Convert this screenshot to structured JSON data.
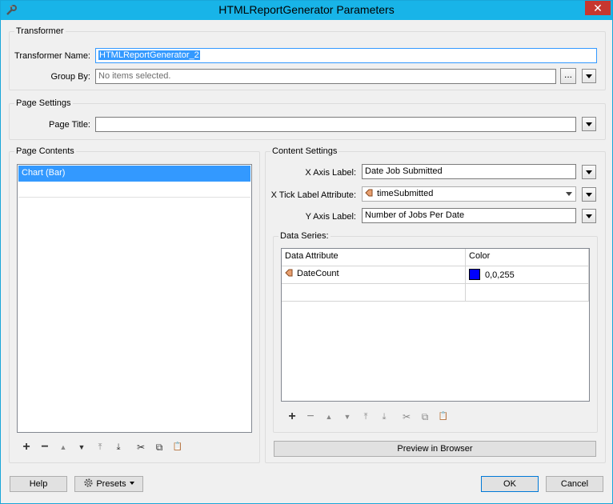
{
  "window": {
    "title": "HTMLReportGenerator Parameters",
    "close_glyph": "✕",
    "app_icon": "fme-wrench-icon"
  },
  "transformer": {
    "group_title": "Transformer",
    "name_label": "Transformer Name:",
    "name_value": "HTMLReportGenerator_2",
    "group_by_label": "Group By:",
    "group_by_placeholder": "No items selected.",
    "ellipsis_label": "..."
  },
  "page_settings": {
    "group_title": "Page Settings",
    "page_title_label": "Page Title:",
    "page_title_value": ""
  },
  "page_contents": {
    "group_title": "Page Contents",
    "items": [
      "Chart (Bar)"
    ]
  },
  "content_settings": {
    "group_title": "Content Settings",
    "x_axis_label_label": "X Axis Label:",
    "x_axis_label_value": "Date Job Submitted",
    "x_tick_label": "X Tick Label Attribute:",
    "x_tick_value": "timeSubmitted",
    "y_axis_label_label": "Y Axis Label:",
    "y_axis_label_value": "Number of Jobs Per Date",
    "data_series": {
      "group_title": "Data Series:",
      "columns": [
        "Data Attribute",
        "Color"
      ],
      "rows": [
        {
          "attribute": "DateCount",
          "color": "0,0,255",
          "color_hex": "#0000ff"
        }
      ]
    },
    "preview_button": "Preview in Browser"
  },
  "toolbar_icons": {
    "add": "+",
    "remove": "−",
    "up": "▲",
    "down": "▼",
    "top": "⤒",
    "bottom": "⤓",
    "cut": "✂",
    "copy": "⧉",
    "paste": "📋"
  },
  "footer": {
    "help": "Help",
    "presets": "Presets",
    "ok": "OK",
    "cancel": "Cancel"
  },
  "colors": {
    "title_bar": "#18b4e8",
    "selection": "#3399ff",
    "close": "#c7372f",
    "attribute_icon": "#e8a070"
  }
}
